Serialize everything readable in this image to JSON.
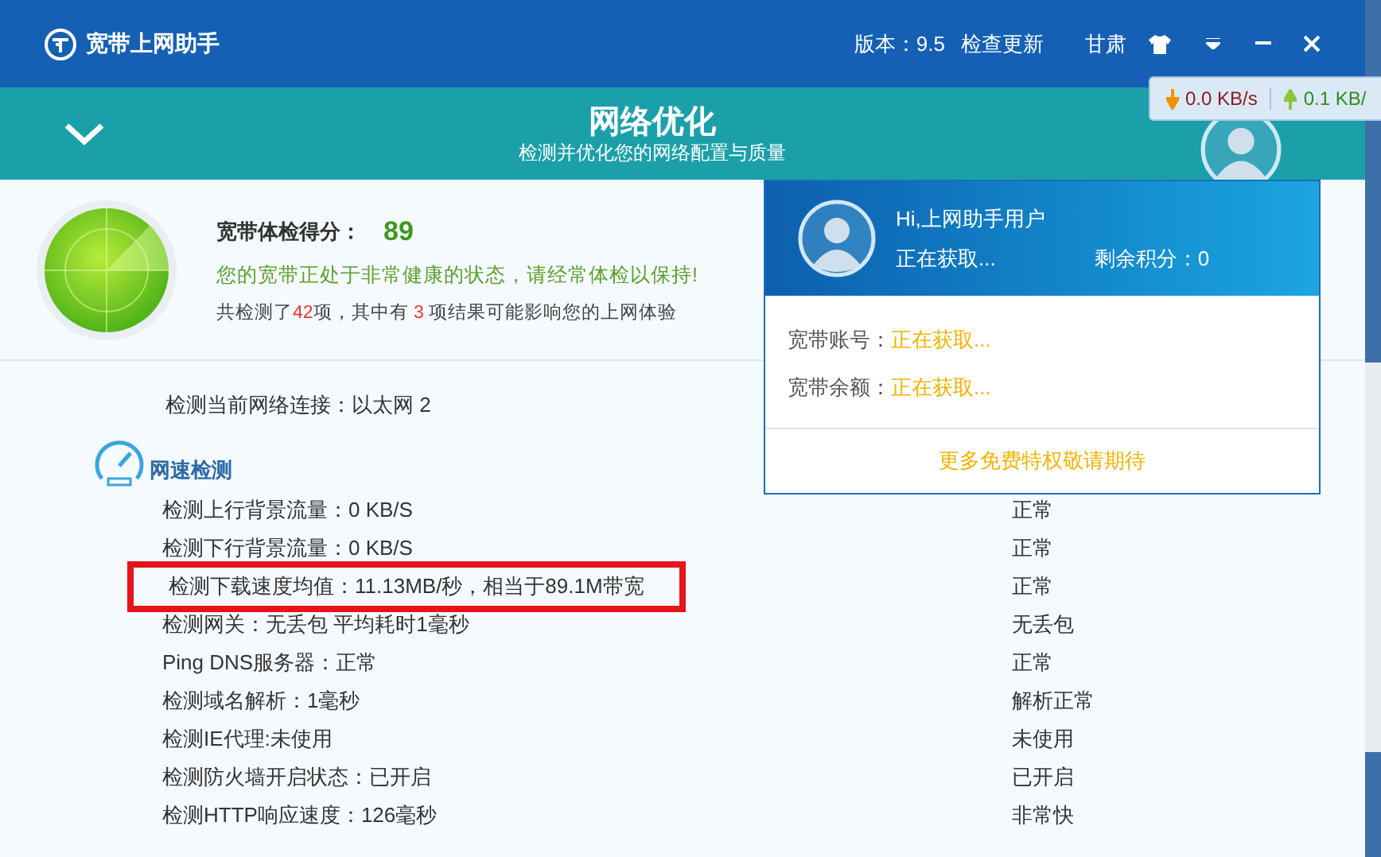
{
  "window": {
    "title": "宽带上网助手",
    "version": "版本：9.5",
    "update_link": "检查更新",
    "region": "甘肃"
  },
  "speed_widget": {
    "download": "0.0 KB/s",
    "upload": "0.1 KB/"
  },
  "header": {
    "title": "网络优化",
    "subtitle": "检测并优化您的网络配置与质量"
  },
  "score_panel": {
    "label": "宽带体检得分：",
    "score": "89",
    "message": "您的宽带正处于非常健康的状态，请经常体检以保持!",
    "summary": [
      {
        "text": "共检测了",
        "highlight": false
      },
      {
        "text": "42",
        "highlight": true
      },
      {
        "text": "项，其中有 ",
        "highlight": false
      },
      {
        "text": "3",
        "highlight": true
      },
      {
        "text": " 项结果可能影响您的上网体验",
        "highlight": false
      }
    ]
  },
  "user_popup": {
    "greeting": "Hi,上网助手用户",
    "status": "正在获取...",
    "points": "剩余积分：0",
    "fields": [
      {
        "label": "宽带账号：",
        "value": "正在获取..."
      },
      {
        "label": "宽带余额：",
        "value": "正在获取..."
      }
    ],
    "footer_link": "更多免费特权敬请期待"
  },
  "intro_rows": [
    {
      "text": "检测当前网络连接：以太网 2"
    }
  ],
  "section": {
    "title": "网速检测"
  },
  "results": [
    {
      "item": "检测上行背景流量：0 KB/S",
      "status": "正常",
      "highlighted": false
    },
    {
      "item": "检测下行背景流量：0 KB/S",
      "status": "正常",
      "highlighted": false
    },
    {
      "item": "检测下载速度均值：11.13MB/秒，相当于89.1M带宽",
      "status": "正常",
      "highlighted": true
    },
    {
      "item": "检测网关：无丢包 平均耗时1毫秒",
      "status": "无丢包",
      "highlighted": false
    },
    {
      "item": "Ping DNS服务器：正常",
      "status": "正常",
      "highlighted": false
    },
    {
      "item": "检测域名解析：1毫秒",
      "status": "解析正常",
      "highlighted": false
    },
    {
      "item": "检测IE代理:未使用",
      "status": "未使用",
      "highlighted": false
    },
    {
      "item": "检测防火墙开启状态：已开启",
      "status": "已开启",
      "highlighted": false
    },
    {
      "item": "检测HTTP响应速度：126毫秒",
      "status": "非常快",
      "highlighted": false
    }
  ]
}
